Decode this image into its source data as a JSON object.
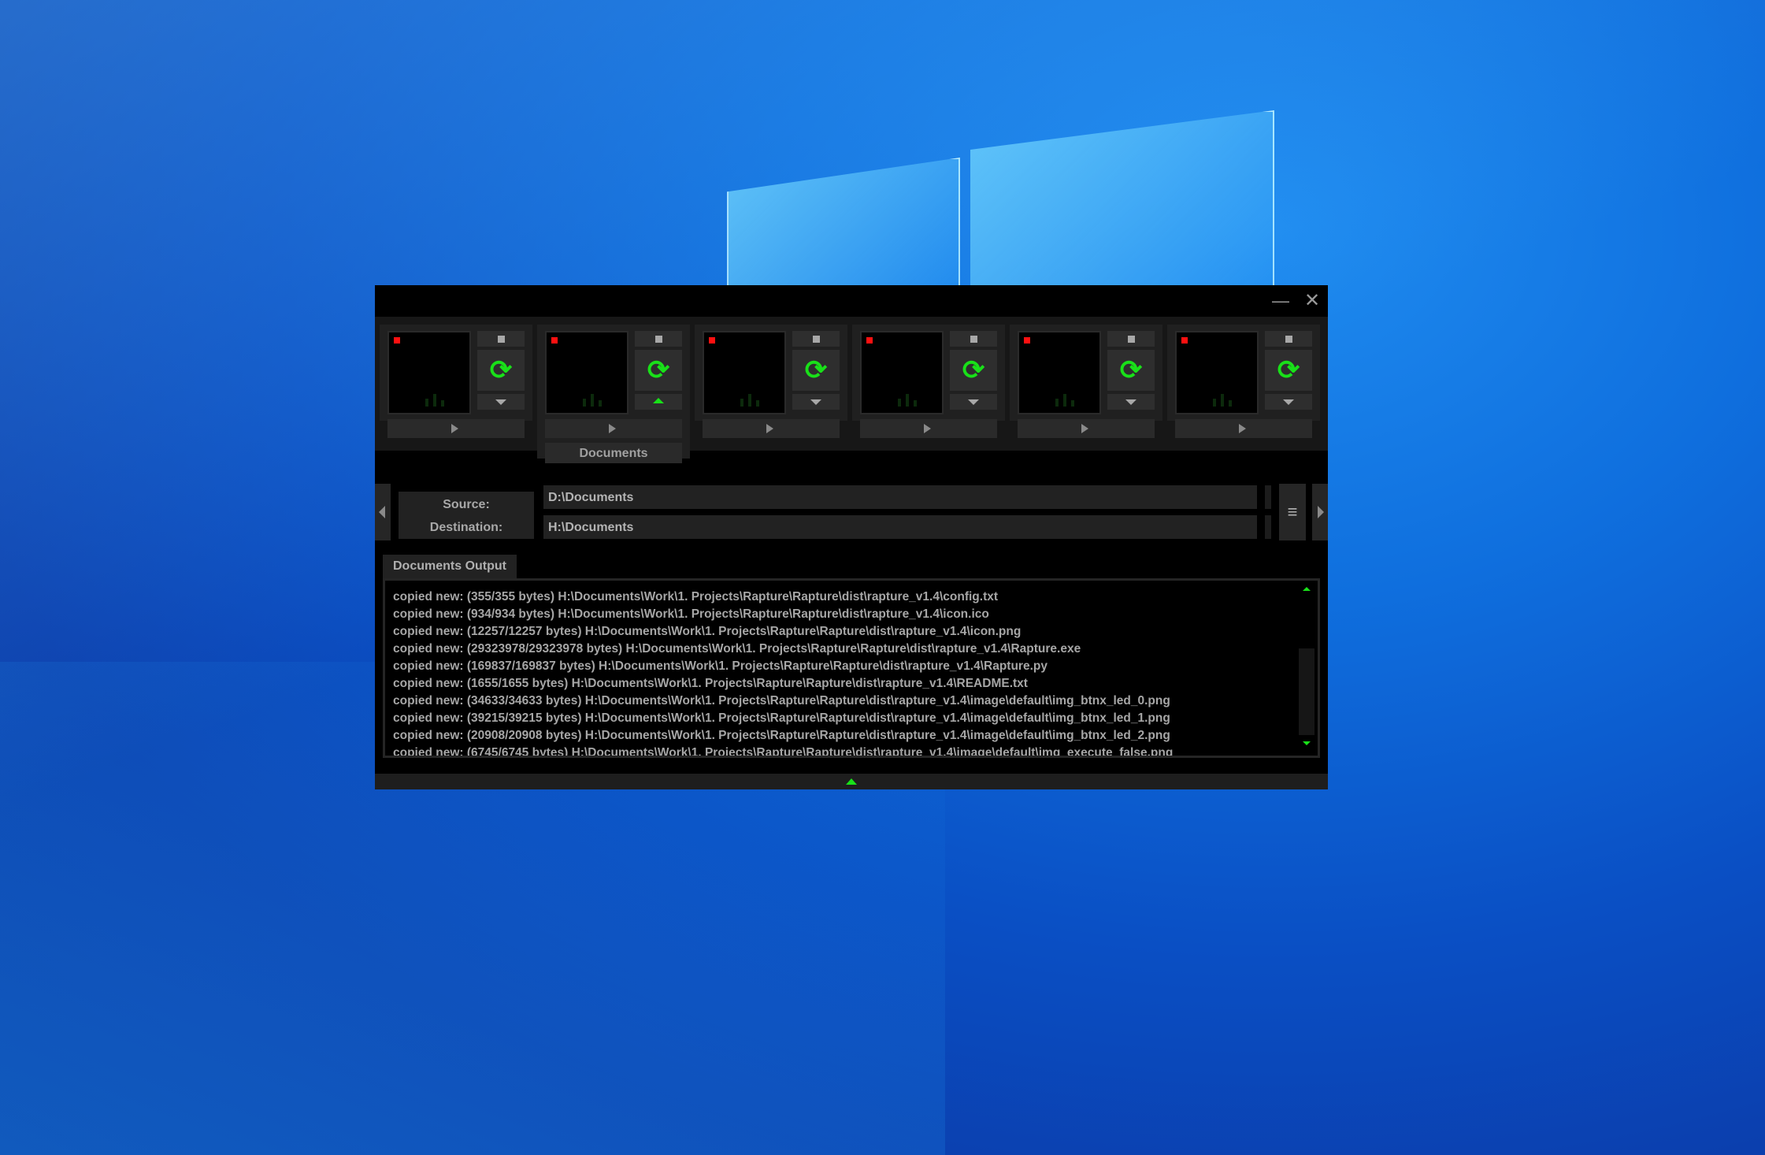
{
  "window": {
    "minimize_symbol": "—",
    "close_symbol": "✕"
  },
  "slots": [
    {
      "led_color": "#ff1010",
      "expanded": false,
      "label": ""
    },
    {
      "led_color": "#ff1010",
      "expanded": true,
      "label": "Documents"
    },
    {
      "led_color": "#ff1010",
      "expanded": false,
      "label": ""
    },
    {
      "led_color": "#ff1010",
      "expanded": false,
      "label": ""
    },
    {
      "led_color": "#ff1010",
      "expanded": false,
      "label": ""
    },
    {
      "led_color": "#ff1010",
      "expanded": false,
      "label": ""
    }
  ],
  "paths": {
    "source_label": "Source:",
    "source_value": "D:\\Documents",
    "destination_label": "Destination:",
    "destination_value": "H:\\Documents",
    "menu_icon": "≡"
  },
  "output": {
    "tab_label": "Documents Output",
    "lines": [
      "copied new: (355/355 bytes) H:\\Documents\\Work\\1. Projects\\Rapture\\Rapture\\dist\\rapture_v1.4\\config.txt",
      "copied new: (934/934 bytes) H:\\Documents\\Work\\1. Projects\\Rapture\\Rapture\\dist\\rapture_v1.4\\icon.ico",
      "copied new: (12257/12257 bytes) H:\\Documents\\Work\\1. Projects\\Rapture\\Rapture\\dist\\rapture_v1.4\\icon.png",
      "copied new: (29323978/29323978 bytes) H:\\Documents\\Work\\1. Projects\\Rapture\\Rapture\\dist\\rapture_v1.4\\Rapture.exe",
      "copied new: (169837/169837 bytes) H:\\Documents\\Work\\1. Projects\\Rapture\\Rapture\\dist\\rapture_v1.4\\Rapture.py",
      "copied new: (1655/1655 bytes) H:\\Documents\\Work\\1. Projects\\Rapture\\Rapture\\dist\\rapture_v1.4\\README.txt",
      "copied new: (34633/34633 bytes) H:\\Documents\\Work\\1. Projects\\Rapture\\Rapture\\dist\\rapture_v1.4\\image\\default\\img_btnx_led_0.png",
      "copied new: (39215/39215 bytes) H:\\Documents\\Work\\1. Projects\\Rapture\\Rapture\\dist\\rapture_v1.4\\image\\default\\img_btnx_led_1.png",
      "copied new: (20908/20908 bytes) H:\\Documents\\Work\\1. Projects\\Rapture\\Rapture\\dist\\rapture_v1.4\\image\\default\\img_btnx_led_2.png",
      "copied new: (6745/6745 bytes) H:\\Documents\\Work\\1. Projects\\Rapture\\Rapture\\dist\\rapture_v1.4\\image\\default\\img_execute_false.png"
    ]
  },
  "colors": {
    "accent_green": "#19e019",
    "led_red": "#ff1010"
  },
  "icons": {
    "sync": "⟳"
  }
}
